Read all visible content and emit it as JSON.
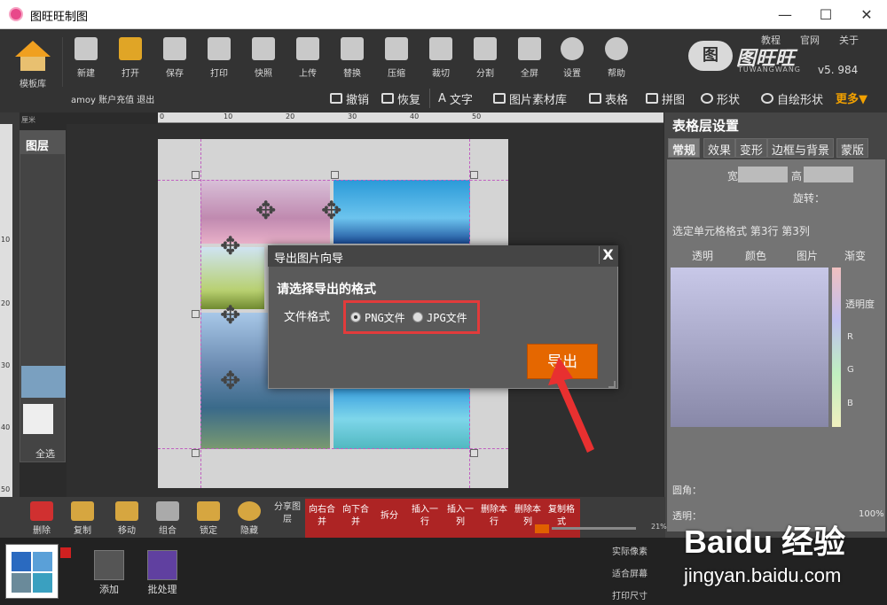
{
  "window": {
    "title": "图旺旺制图",
    "minimize": "—",
    "maximize": "☐",
    "close": "✕"
  },
  "toolbar": {
    "home": "模板库",
    "buttons": [
      "新建",
      "打开",
      "保存",
      "打印",
      "快照",
      "上传",
      "替换",
      "压缩",
      "裁切",
      "分割",
      "全屏",
      "设置",
      "帮助"
    ],
    "links": [
      "教程",
      "官网",
      "关于"
    ],
    "brand": "图旺旺",
    "brand_sub": "TUWANGWANG",
    "version": "v5. 984",
    "user": "amoy 账户充值 退出",
    "row2": [
      "撤销",
      "恢复",
      "文字",
      "图片素材库",
      "表格",
      "拼图",
      "形状",
      "自绘形状"
    ],
    "more": "更多▼"
  },
  "ruler": {
    "unit_label": "厘米",
    "ticks": [
      "0",
      "10",
      "20",
      "30",
      "40",
      "50",
      "60"
    ],
    "vticks": [
      "10",
      "20",
      "30",
      "40",
      "50"
    ]
  },
  "layers": {
    "title": "图层",
    "select_all": "全选"
  },
  "right_panel": {
    "title": "表格层设置",
    "tabs": [
      "常规",
      "效果",
      "变形",
      "边框与背景",
      "蒙版"
    ],
    "width_label": "宽",
    "height_label": "高",
    "rotate_label": "旋转：",
    "cell_format": "选定单元格格式 第3行 第3列",
    "subtabs": [
      "透明",
      "颜色",
      "图片",
      "渐变"
    ],
    "opacity_label": "透明度",
    "corner_label": "圆角：",
    "transparency_label": "透明：",
    "transparency_value": "100%",
    "rgb": [
      "R",
      "G",
      "B"
    ]
  },
  "bottom_toolbar": {
    "buttons": [
      "删除",
      "复制",
      "移动",
      "组合",
      "锁定",
      "隐藏"
    ],
    "share": "分享图层",
    "red_buttons": [
      "向右合并",
      "向下合并",
      "拆分",
      "插入一行",
      "插入一列",
      "删除本行",
      "删除本列",
      "复制格式"
    ],
    "zoom": "21%"
  },
  "filmstrip": {
    "add": "添加",
    "batch": "批处理",
    "side": [
      "实际像素",
      "适合屏幕",
      "打印尺寸"
    ]
  },
  "dialog": {
    "title": "导出图片向导",
    "close": "X",
    "prompt": "请选择导出的格式",
    "format_label": "文件格式",
    "options": [
      "PNG文件",
      "JPG文件"
    ],
    "selected": "PNG文件",
    "export_button": "导出"
  },
  "watermark": {
    "logo": "Baidu 经验",
    "url": "jingyan.baidu.com"
  }
}
